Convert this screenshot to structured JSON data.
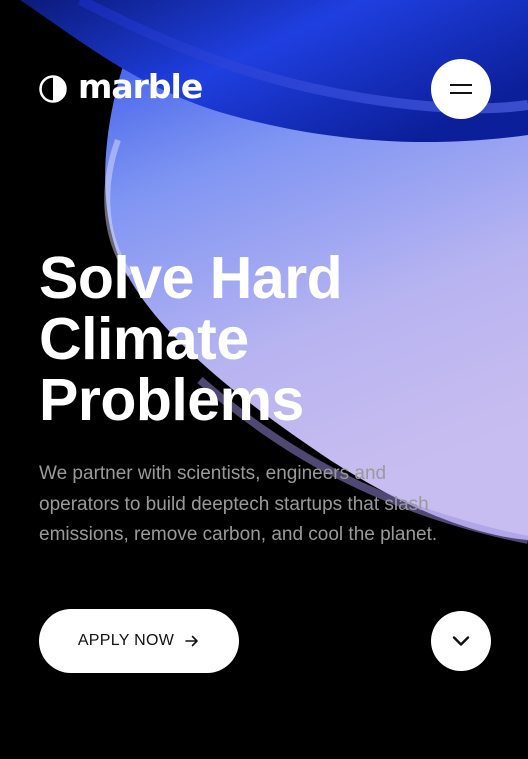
{
  "brand": {
    "name": "marble",
    "logo_icon": "half-circle-logo-icon"
  },
  "header": {
    "menu_icon": "hamburger-menu-icon"
  },
  "hero": {
    "headline_lines": [
      "Solve Hard",
      "Climate",
      "Problems"
    ],
    "description": "We partner with scientists, engineers and operators to build deeptech startups that slash emissions, remove carbon, and cool the planet.",
    "apply_label": "APPLY NOW",
    "apply_icon": "arrow-right-icon",
    "scroll_icon": "chevron-down-icon"
  },
  "colors": {
    "background": "#000000",
    "text": "#ffffff",
    "muted_text": "#9a9a9a",
    "accent_blue": "#1f3fe0",
    "accent_lavender": "#b7b0ee"
  }
}
